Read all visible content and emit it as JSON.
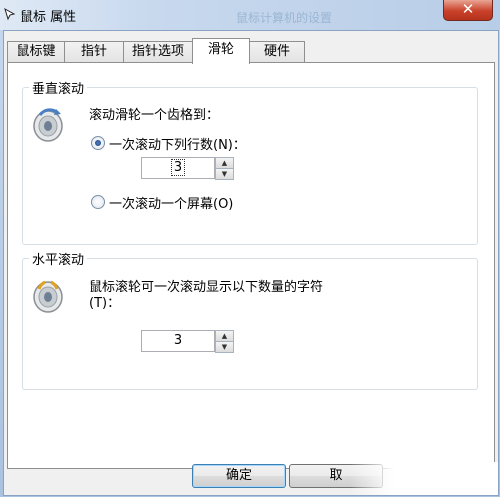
{
  "window": {
    "title": "鼠标 属性",
    "ghost_title": "鼠标计算机的设置",
    "close_label": "✕"
  },
  "tabs": [
    {
      "label": "鼠标键"
    },
    {
      "label": "指针"
    },
    {
      "label": "指针选项"
    },
    {
      "label": "滑轮"
    },
    {
      "label": "硬件"
    }
  ],
  "vertical": {
    "group_title": "垂直滚动",
    "prompt": "滚动滑轮一个齿格到：",
    "option_lines": "一次滚动下列行数(N)：",
    "lines_value": "3",
    "option_screen": "一次滚动一个屏幕(O)"
  },
  "horizontal": {
    "group_title": "水平滚动",
    "prompt_line1": "鼠标滚轮可一次滚动显示以下数量的字符",
    "prompt_line2": "(T)：",
    "chars_value": "3"
  },
  "buttons": {
    "ok": "确定",
    "cancel": "取"
  },
  "icons": {
    "wheel": "mouse-wheel-icon",
    "up": "▲",
    "down": "▼"
  }
}
